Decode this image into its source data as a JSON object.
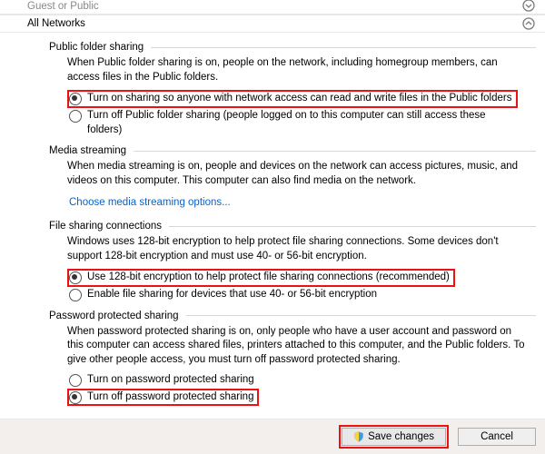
{
  "sections": {
    "guest": {
      "title": "Guest or Public"
    },
    "all": {
      "title": "All Networks"
    }
  },
  "publicFolder": {
    "heading": "Public folder sharing",
    "desc": "When Public folder sharing is on, people on the network, including homegroup members, can access files in the Public folders.",
    "optOn": "Turn on sharing so anyone with network access can read and write files in the Public folders",
    "optOff": "Turn off Public folder sharing (people logged on to this computer can still access these folders)"
  },
  "media": {
    "heading": "Media streaming",
    "desc": "When media streaming is on, people and devices on the network can access pictures, music, and videos on this computer. This computer can also find media on the network.",
    "link": "Choose media streaming options..."
  },
  "fileShare": {
    "heading": "File sharing connections",
    "desc": "Windows uses 128-bit encryption to help protect file sharing connections. Some devices don't support 128-bit encryption and must use 40- or 56-bit encryption.",
    "opt128": "Use 128-bit encryption to help protect file sharing connections (recommended)",
    "opt40": "Enable file sharing for devices that use 40- or 56-bit encryption"
  },
  "password": {
    "heading": "Password protected sharing",
    "desc": "When password protected sharing is on, only people who have a user account and password on this computer can access shared files, printers attached to this computer, and the Public folders. To give other people access, you must turn off password protected sharing.",
    "optOn": "Turn on password protected sharing",
    "optOff": "Turn off password protected sharing"
  },
  "buttons": {
    "save": "Save changes",
    "cancel": "Cancel"
  }
}
